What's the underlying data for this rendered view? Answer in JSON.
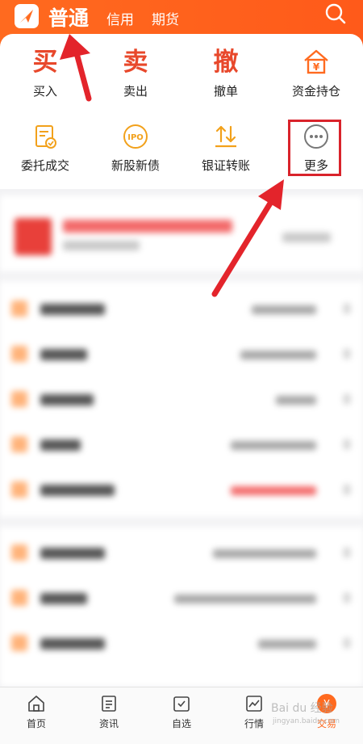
{
  "header": {
    "tabs": [
      {
        "label": "普通"
      },
      {
        "label": "信用"
      },
      {
        "label": "期货"
      }
    ]
  },
  "actions_row1": [
    {
      "glyph": "买",
      "label": "买入"
    },
    {
      "glyph": "卖",
      "label": "卖出"
    },
    {
      "glyph": "撤",
      "label": "撤单"
    },
    {
      "icon": "yuan-house-icon",
      "label": "资金持仓"
    }
  ],
  "actions_row2": [
    {
      "icon": "order-check-icon",
      "label": "委托成交"
    },
    {
      "icon": "ipo-icon",
      "label": "新股新债",
      "icon_text": "IPO"
    },
    {
      "icon": "transfer-icon",
      "label": "银证转账"
    },
    {
      "icon": "more-icon",
      "label": "更多"
    }
  ],
  "tabbar": {
    "items": [
      {
        "label": "首页",
        "icon": "home-icon"
      },
      {
        "label": "资讯",
        "icon": "news-icon"
      },
      {
        "label": "自选",
        "icon": "watchlist-icon"
      },
      {
        "label": "行情",
        "icon": "market-icon"
      },
      {
        "label": "交易",
        "icon": "trade-yuan-icon",
        "badge": "¥"
      }
    ]
  },
  "watermark": {
    "line1": "Bai du 经验",
    "line2": "jingyan.baidu.com"
  },
  "colors": {
    "brand": "#ff6a1f",
    "highlight": "#d9232b",
    "arrow": "#e3242b"
  }
}
